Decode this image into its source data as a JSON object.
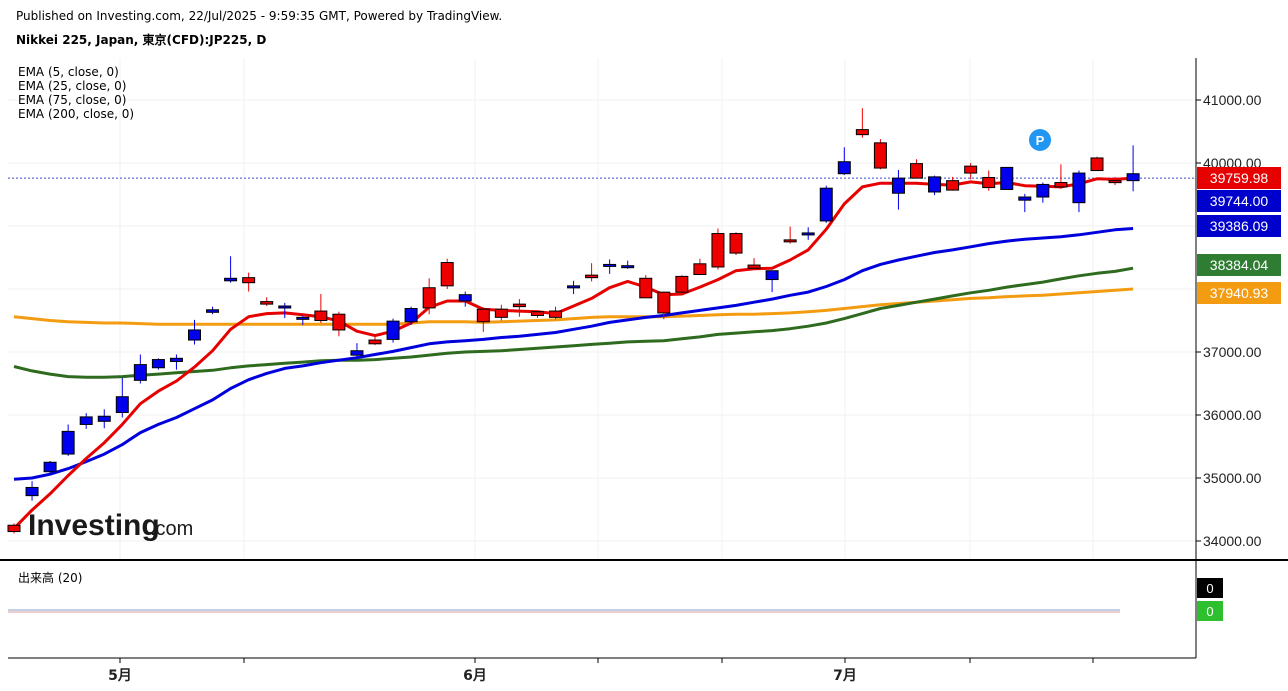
{
  "header": {
    "published": "Published on Investing.com, 22/Jul/2025 - 9:59:35 GMT, Powered by TradingView.",
    "symbol": "Nikkei 225, Japan, 東京(CFD):JP225, D"
  },
  "legend": {
    "ema5": "EMA (5, close, 0)",
    "ema25": "EMA (25, close, 0)",
    "ema75": "EMA (75, close, 0)",
    "ema200": "EMA (200, close, 0)",
    "volume": "出来高 (20)"
  },
  "logo": {
    "brand": "Investing",
    "suffix": ".com"
  },
  "chart_data": {
    "type": "candlestick",
    "y_ticks": [
      "41000.00",
      "40000.00",
      "37000.00",
      "36000.00",
      "35000.00",
      "34000.00"
    ],
    "x_ticks": [
      "5月",
      "6月",
      "7月"
    ],
    "ylim": [
      33800,
      41600
    ],
    "last_price_line": 39759.98,
    "price_tags": [
      {
        "label": "39759.98",
        "color": "#e60000"
      },
      {
        "label": "39744.00",
        "color": "#0000cc"
      },
      {
        "label": "39386.09",
        "color": "#0000cc"
      },
      {
        "label": "38384.04",
        "color": "#2e7d32"
      },
      {
        "label": "37940.93",
        "color": "#f39c12"
      }
    ],
    "candles_ohlc": [
      [
        34250,
        34280,
        34120,
        34150
      ],
      [
        34720,
        34950,
        34640,
        34850
      ],
      [
        35100,
        35270,
        35050,
        35250
      ],
      [
        35380,
        35850,
        35350,
        35740
      ],
      [
        35850,
        36030,
        35780,
        35970
      ],
      [
        35900,
        36090,
        35790,
        35980
      ],
      [
        36040,
        36590,
        35960,
        36290
      ],
      [
        36550,
        36960,
        36500,
        36800
      ],
      [
        36750,
        36900,
        36720,
        36880
      ],
      [
        36850,
        36960,
        36720,
        36900
      ],
      [
        37190,
        37510,
        37120,
        37350
      ],
      [
        37630,
        37720,
        37600,
        37670
      ],
      [
        38130,
        38520,
        38100,
        38170
      ],
      [
        38180,
        38260,
        37960,
        38100
      ],
      [
        37800,
        37870,
        37730,
        37760
      ],
      [
        37720,
        37780,
        37540,
        37730
      ],
      [
        37520,
        37580,
        37430,
        37550
      ],
      [
        37650,
        37920,
        37460,
        37500
      ],
      [
        37600,
        37640,
        37250,
        37350
      ],
      [
        36950,
        37140,
        36920,
        37020
      ],
      [
        37190,
        37250,
        37110,
        37130
      ],
      [
        37200,
        37530,
        37150,
        37490
      ],
      [
        37480,
        37720,
        37430,
        37690
      ],
      [
        38020,
        38170,
        37600,
        37700
      ],
      [
        38420,
        38480,
        38000,
        38050
      ],
      [
        37810,
        37960,
        37720,
        37910
      ],
      [
        37680,
        37710,
        37320,
        37480
      ],
      [
        37680,
        37750,
        37500,
        37550
      ],
      [
        37760,
        37840,
        37560,
        37720
      ],
      [
        37640,
        37660,
        37540,
        37580
      ],
      [
        37650,
        37720,
        37520,
        37550
      ],
      [
        38030,
        38130,
        37920,
        38050
      ],
      [
        38220,
        38410,
        38120,
        38180
      ],
      [
        38380,
        38470,
        38240,
        38390
      ],
      [
        38340,
        38450,
        38320,
        38370
      ],
      [
        38170,
        38220,
        37860,
        37860
      ],
      [
        37950,
        37960,
        37520,
        37620
      ],
      [
        38200,
        38220,
        37950,
        37950
      ],
      [
        38400,
        38480,
        38240,
        38230
      ],
      [
        38880,
        38960,
        38310,
        38350
      ],
      [
        38880,
        38900,
        38540,
        38570
      ],
      [
        38380,
        38490,
        38310,
        38330
      ],
      [
        38150,
        38230,
        37950,
        38290
      ],
      [
        38780,
        38990,
        38720,
        38770
      ],
      [
        38880,
        38980,
        38780,
        38890
      ],
      [
        39080,
        39640,
        39050,
        39600
      ],
      [
        39830,
        40250,
        39810,
        40020
      ],
      [
        40530,
        40870,
        40400,
        40450
      ],
      [
        40320,
        40380,
        39900,
        39920
      ],
      [
        39520,
        39890,
        39260,
        39760
      ],
      [
        39990,
        40060,
        39780,
        39760
      ],
      [
        39540,
        39800,
        39490,
        39780
      ],
      [
        39720,
        39780,
        39560,
        39570
      ],
      [
        39950,
        40000,
        39740,
        39840
      ],
      [
        39770,
        39880,
        39560,
        39610
      ],
      [
        39580,
        39930,
        39610,
        39930
      ],
      [
        39410,
        39510,
        39220,
        39460
      ],
      [
        39460,
        39690,
        39370,
        39660
      ],
      [
        39690,
        39980,
        39590,
        39620
      ],
      [
        39370,
        39880,
        39220,
        39840
      ],
      [
        40080,
        40100,
        39890,
        39880
      ],
      [
        39720,
        39780,
        39650,
        39700
      ],
      [
        39720,
        40280,
        39550,
        39830
      ]
    ],
    "ema5": [
      34200,
      34490,
      34750,
      35040,
      35310,
      35560,
      35850,
      36180,
      36380,
      36540,
      36760,
      37020,
      37360,
      37560,
      37610,
      37620,
      37590,
      37560,
      37490,
      37330,
      37260,
      37330,
      37460,
      37710,
      37810,
      37810,
      37680,
      37660,
      37650,
      37640,
      37610,
      37730,
      37850,
      38020,
      38120,
      38030,
      37910,
      37920,
      38030,
      38150,
      38290,
      38320,
      38330,
      38460,
      38620,
      38950,
      39350,
      39620,
      39680,
      39680,
      39680,
      39660,
      39650,
      39700,
      39670,
      39690,
      39640,
      39630,
      39620,
      39670,
      39750,
      39740,
      39760
    ],
    "ema25": [
      34980,
      35000,
      35060,
      35150,
      35260,
      35380,
      35530,
      35720,
      35850,
      35960,
      36100,
      36240,
      36420,
      36560,
      36660,
      36740,
      36780,
      36830,
      36870,
      36910,
      36960,
      37010,
      37070,
      37130,
      37160,
      37180,
      37200,
      37230,
      37250,
      37280,
      37310,
      37360,
      37410,
      37470,
      37510,
      37550,
      37580,
      37620,
      37660,
      37700,
      37740,
      37790,
      37840,
      37900,
      37950,
      38040,
      38150,
      38290,
      38390,
      38460,
      38520,
      38580,
      38620,
      38670,
      38720,
      38760,
      38790,
      38810,
      38830,
      38860,
      38900,
      38940,
      38960
    ],
    "ema75": [
      36770,
      36700,
      36650,
      36610,
      36600,
      36600,
      36610,
      36630,
      36650,
      36670,
      36690,
      36710,
      36750,
      36780,
      36800,
      36820,
      36840,
      36860,
      36870,
      36870,
      36880,
      36900,
      36920,
      36950,
      36980,
      37000,
      37010,
      37020,
      37040,
      37060,
      37080,
      37100,
      37120,
      37140,
      37160,
      37170,
      37180,
      37210,
      37240,
      37280,
      37300,
      37320,
      37340,
      37370,
      37410,
      37460,
      37530,
      37610,
      37690,
      37740,
      37790,
      37840,
      37890,
      37940,
      37980,
      38030,
      38070,
      38110,
      38160,
      38210,
      38250,
      38280,
      38330
    ],
    "ema200": [
      37560,
      37530,
      37500,
      37480,
      37470,
      37460,
      37460,
      37450,
      37440,
      37440,
      37440,
      37440,
      37440,
      37440,
      37440,
      37440,
      37440,
      37440,
      37440,
      37440,
      37440,
      37440,
      37460,
      37480,
      37480,
      37480,
      37470,
      37480,
      37490,
      37500,
      37510,
      37530,
      37550,
      37560,
      37560,
      37560,
      37560,
      37570,
      37580,
      37590,
      37600,
      37600,
      37610,
      37620,
      37640,
      37660,
      37690,
      37720,
      37750,
      37770,
      37790,
      37810,
      37830,
      37850,
      37860,
      37880,
      37890,
      37900,
      37920,
      37940,
      37960,
      37980,
      38000
    ]
  }
}
